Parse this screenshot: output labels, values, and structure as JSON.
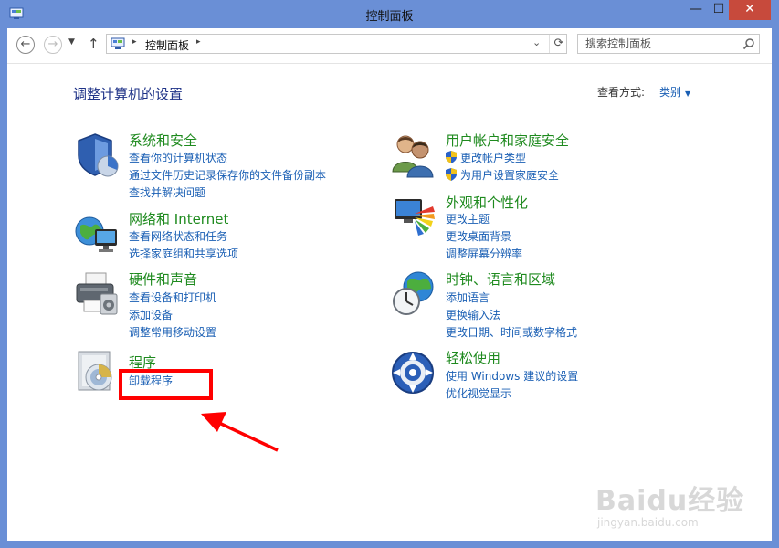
{
  "window": {
    "title": "控制面板",
    "minimize": "—",
    "maximize": "☐",
    "close": "✕"
  },
  "nav": {
    "back_glyph": "←",
    "forward_glyph": "→",
    "recent_glyph": "▼",
    "up_glyph": "↑",
    "address_separator": "▸",
    "address_crumb": "控制面板",
    "address_dropdown_glyph": "⌄",
    "refresh_glyph": "⟳",
    "search_placeholder": "搜索控制面板"
  },
  "main": {
    "heading": "调整计算机的设置",
    "view_by_label": "查看方式:",
    "view_by_value": "类别",
    "view_by_arrow": "▼"
  },
  "categories": [
    {
      "title": "系统和安全",
      "icon": "shield-icon",
      "links": [
        "查看你的计算机状态",
        "通过文件历史记录保存你的文件备份副本",
        "查找并解决问题"
      ]
    },
    {
      "title": "网络和 Internet",
      "icon": "network-globe-icon",
      "links": [
        "查看网络状态和任务",
        "选择家庭组和共享选项"
      ]
    },
    {
      "title": "硬件和声音",
      "icon": "printer-icon",
      "links": [
        "查看设备和打印机",
        "添加设备",
        "调整常用移动设置"
      ]
    },
    {
      "title": "程序",
      "icon": "programs-box-icon",
      "links": [
        "卸载程序"
      ]
    },
    {
      "title": "用户帐户和家庭安全",
      "icon": "users-icon",
      "links": [
        "更改帐户类型",
        "为用户设置家庭安全"
      ]
    },
    {
      "title": "外观和个性化",
      "icon": "appearance-icon",
      "links": [
        "更改主题",
        "更改桌面背景",
        "调整屏幕分辨率"
      ]
    },
    {
      "title": "时钟、语言和区域",
      "icon": "clock-globe-icon",
      "links": [
        "添加语言",
        "更换输入法",
        "更改日期、时间或数字格式"
      ]
    },
    {
      "title": "轻松使用",
      "icon": "ease-of-access-icon",
      "links": [
        "使用 Windows 建议的设置",
        "优化视觉显示"
      ]
    }
  ],
  "watermark": {
    "brand": "Baidu经验",
    "site": "jingyan.baidu.com"
  },
  "colors": {
    "title_bar": "#6a8fd6",
    "category_title": "#1e8a1e",
    "link": "#1a5fb4",
    "heading": "#1e3287",
    "annotation": "#ff0000"
  }
}
